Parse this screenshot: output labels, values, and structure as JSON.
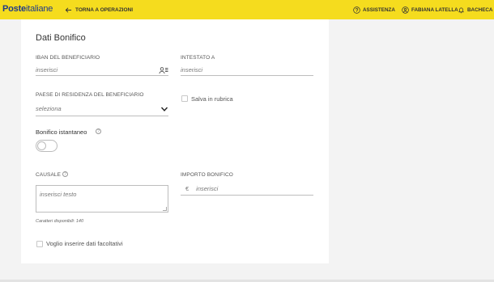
{
  "header": {
    "logo_bold": "Poste",
    "logo_light": "italiane",
    "back_label": "TORNA A OPERAZIONI",
    "assistenza": "ASSISTENZA",
    "user_name": "FABIANA LATELLA",
    "bacheca": "BACHECA",
    "bar_color": "#f5dc1e"
  },
  "form": {
    "title": "Dati Bonifico",
    "iban_label": "IBAN DEL BENEFICIARIO",
    "iban_placeholder": "inserisci",
    "intestato_label": "INTESTATO A",
    "intestato_placeholder": "inserisci",
    "paese_label": "PAESE DI RESIDENZA DEL BENEFICIARIO",
    "paese_value": "seleziona",
    "salva_label": "Salva in rubrica",
    "istantaneo_label": "Bonifico istantaneo",
    "istantaneo_on": false,
    "causale_label": "CAUSALE",
    "causale_placeholder": "inserisci testo",
    "caratteri_hint": "Caratteri disponibili: 140",
    "importo_label": "IMPORTO BONIFICO",
    "currency_symbol": "€",
    "importo_placeholder": "inserisci",
    "facoltativi_label": "Voglio inserire dati facoltativi"
  },
  "icons": {
    "back": "arrow-left-icon",
    "assistenza": "help-circle-icon",
    "user": "user-icon",
    "bacheca": "bell-icon",
    "rubrica": "contact-book-icon",
    "select": "chevron-down-icon",
    "info": "question-circle-icon"
  }
}
